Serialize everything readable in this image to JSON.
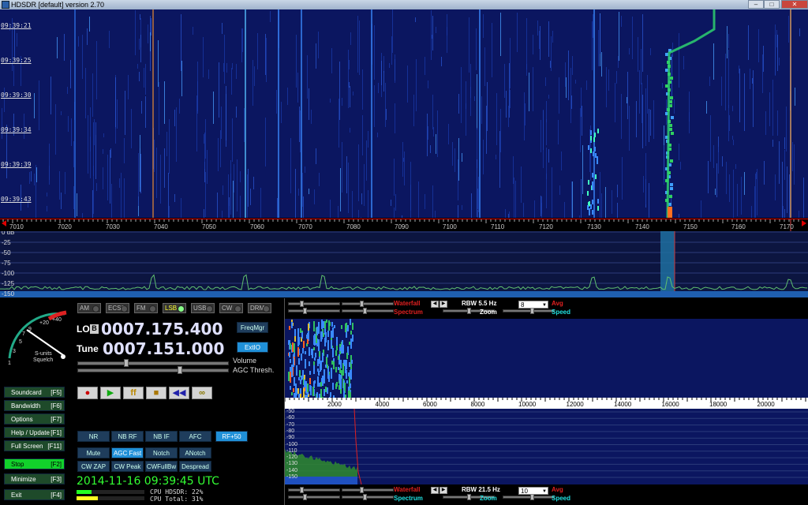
{
  "window": {
    "title": "HDSDR [default]  version 2.70",
    "min": "–",
    "max": "□",
    "close": "✕"
  },
  "waterfall": {
    "times": [
      "09:39:21",
      "09:39:25",
      "09:39:30",
      "09:39:34",
      "09:39:39",
      "09:39:43"
    ]
  },
  "freq_axis": {
    "labels": [
      "7010",
      "7020",
      "7030",
      "7040",
      "7050",
      "7060",
      "7070",
      "7080",
      "7090",
      "7100",
      "7110",
      "7120",
      "7130",
      "7140",
      "7150",
      "7160",
      "7170"
    ]
  },
  "spectrum": {
    "labels": [
      "0 dB",
      "-25",
      "-50",
      "-75",
      "-100",
      "-125",
      "-150"
    ]
  },
  "smeter": {
    "scale_labels": [
      "1",
      "3",
      "5",
      "7",
      "9",
      "+20",
      "+40"
    ],
    "caption1": "S-units",
    "caption2": "Squelch"
  },
  "side_buttons": [
    {
      "label": "Soundcard",
      "key": "[F5]"
    },
    {
      "label": "Bandwidth",
      "key": "[F6]"
    },
    {
      "label": "Options",
      "key": "[F7]"
    },
    {
      "label": "Help / Update",
      "key": "[F1]"
    },
    {
      "label": "Full Screen",
      "key": "[F11]"
    },
    {
      "label": "Stop",
      "key": "[F2]"
    },
    {
      "label": "Minimize",
      "key": "[F3]"
    },
    {
      "label": "Exit",
      "key": "[F4]"
    }
  ],
  "modes": [
    "AM",
    "ECSS",
    "FM",
    "LSB",
    "USB",
    "CW",
    "DRM"
  ],
  "active_mode": "LSB",
  "lo": {
    "label": "LO",
    "badge": "B",
    "value": "0007.175.400"
  },
  "tune": {
    "label": "Tune",
    "value": "0007.151.000"
  },
  "freqmgr": "FreqMgr",
  "extio": "ExtIO",
  "volume_label": "Volume",
  "agc_label": "AGC Thresh.",
  "transport": [
    "●",
    "▶",
    "ff",
    "■",
    "◀◀",
    "∞"
  ],
  "dsp_row1": [
    "NR",
    "NB RF",
    "NB IF",
    "AFC",
    "RF+50"
  ],
  "dsp_row2": [
    "Mute",
    "AGC Fast",
    "Notch",
    "ANotch"
  ],
  "dsp_row3": [
    "CW ZAP",
    "CW Peak",
    "CWFullBw",
    "Despread"
  ],
  "datetime": "2014-11-16   09:39:45 UTC",
  "cpu": {
    "hdsdr": "CPU HDSDR: 22%",
    "total": "CPU Total: 31%"
  },
  "top_controls": {
    "waterfall": "Waterfall",
    "spectrum": "Spectrum",
    "rbw": "RBW  5.5 Hz",
    "zoom": "Zoom",
    "avg": "Avg",
    "speed": "Speed",
    "combo": "8"
  },
  "bottom_controls": {
    "waterfall": "Waterfall",
    "spectrum": "Spectrum",
    "rbw": "RBW  21.5 Hz",
    "zoom": "Zoom",
    "avg": "Avg",
    "speed": "Speed",
    "combo": "10"
  },
  "af_axis": [
    "2000",
    "4000",
    "6000",
    "8000",
    "10000",
    "12000",
    "14000",
    "16000",
    "18000",
    "20000"
  ],
  "af_db": [
    "-50",
    "-60",
    "-70",
    "-80",
    "-90",
    "-100",
    "-110",
    "-120",
    "-130",
    "-140",
    "-150"
  ],
  "colors": {
    "accent": "#2090d8",
    "stop": "#12d12b",
    "freq": "#dfe0ff"
  }
}
